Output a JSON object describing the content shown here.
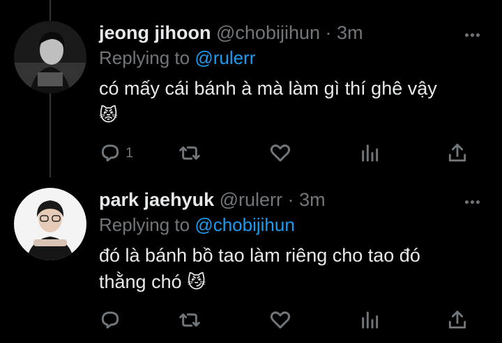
{
  "tweets": [
    {
      "name": "jeong jihoon",
      "handle": "@chobijihun",
      "separator": "·",
      "time": "3m",
      "replying_prefix": "Replying to",
      "replying_to": "@rulerr",
      "text": "có mấy cái bánh à mà làm gì thí ghê vậy",
      "emoji": "😾",
      "reply_count": "1",
      "avatar_icon": "avatar-photo-jeong-jihoon"
    },
    {
      "name": "park jaehyuk",
      "handle": "@rulerr",
      "separator": "·",
      "time": "3m",
      "replying_prefix": "Replying to",
      "replying_to": "@chobijihun",
      "text": "đó là bánh bồ tao làm riêng cho tao đó thằng chó",
      "emoji": "😼",
      "reply_count": "",
      "avatar_icon": "avatar-photo-park-jaehyuk"
    }
  ],
  "icons": [
    "reply-icon",
    "retweet-icon",
    "like-icon",
    "views-icon",
    "share-icon",
    "more-icon"
  ],
  "colors": {
    "background": "#000000",
    "text": "#e7e9ea",
    "muted": "#71767b",
    "link": "#1d9bf0"
  }
}
